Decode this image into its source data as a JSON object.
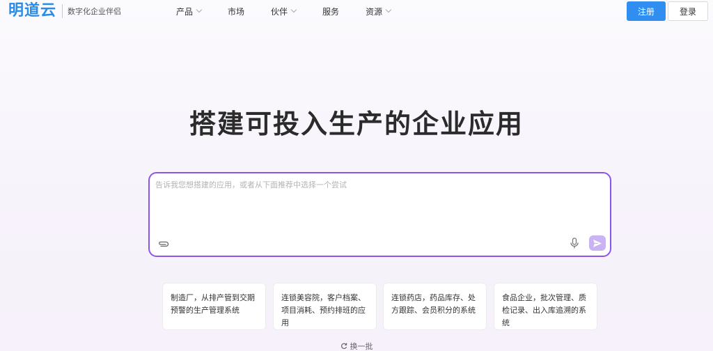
{
  "header": {
    "logo_text": "明道云",
    "tagline": "数字化企业伴侣",
    "nav": [
      {
        "label": "产品",
        "has_dropdown": true
      },
      {
        "label": "市场",
        "has_dropdown": false
      },
      {
        "label": "伙伴",
        "has_dropdown": true
      },
      {
        "label": "服务",
        "has_dropdown": false
      },
      {
        "label": "资源",
        "has_dropdown": true
      }
    ],
    "register_label": "注册",
    "login_label": "登录"
  },
  "hero": {
    "title": "搭建可投入生产的企业应用"
  },
  "prompt": {
    "placeholder": "告诉我您想搭建的应用，或者从下面推荐中选择一个尝试",
    "value": "",
    "icons": {
      "attach": "paperclip-icon",
      "mic": "microphone-icon",
      "send": "send-icon"
    }
  },
  "suggestions": [
    {
      "text": "制造厂，从排产管到交期预警的生产管理系统"
    },
    {
      "text": "连锁美容院，客户档案、项目消耗、预约排班的应用"
    },
    {
      "text": "连锁药店，药品库存、处方跟踪、会员积分的系统"
    },
    {
      "text": "食品企业，批次管理、质检记录、出入库追溯的系统"
    }
  ],
  "refresh_label": "换一批",
  "colors": {
    "brand": "#2a8ce9",
    "primary_button": "#2f8ef0",
    "prompt_border": "#8a55e8",
    "send_button": "#c9b3f5"
  }
}
